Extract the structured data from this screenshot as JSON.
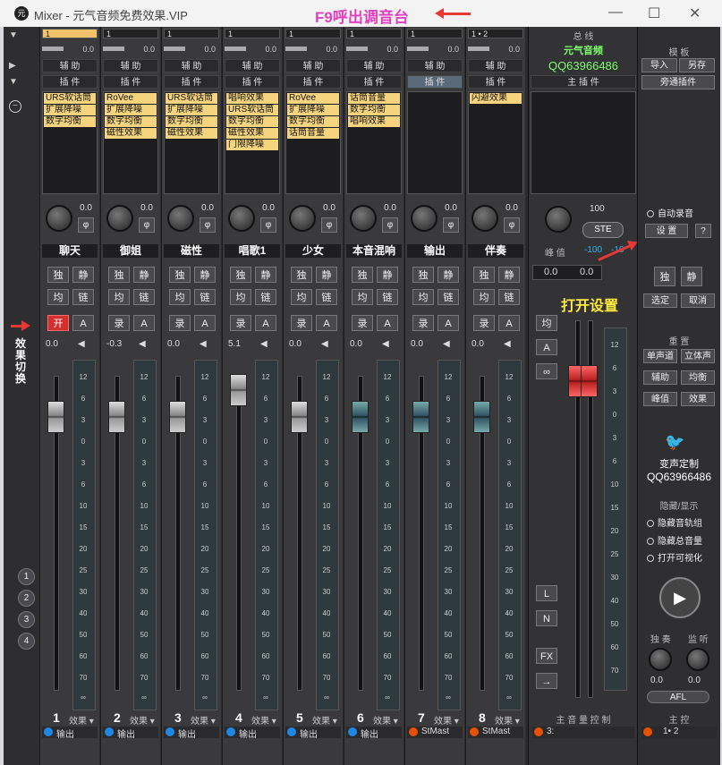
{
  "window": {
    "title": "Mixer - 元气音频免费效果.VIP",
    "annotation": "F9呼出调音台",
    "logo": "元"
  },
  "left": {
    "effect_switch_label": "效果切换",
    "nums": [
      "1",
      "2",
      "3",
      "4"
    ]
  },
  "channels": [
    {
      "select": "1",
      "meter": "0.0",
      "header1": "辅 助",
      "header2": "插 件",
      "plugins": [
        "URS软话筒",
        "扩展降噪",
        "数字均衡"
      ],
      "pan": "0.0",
      "name": "聊天",
      "rec": "开",
      "vol": "0.0",
      "num": "1",
      "fx": "效果",
      "out": "输出",
      "out_color": "blue"
    },
    {
      "select": "1",
      "meter": "0.0",
      "header1": "辅 助",
      "header2": "插 件",
      "plugins": [
        "RoVee",
        "扩展降噪",
        "数字均衡",
        "磁性效果"
      ],
      "pan": "0.0",
      "name": "御姐",
      "rec": "录",
      "vol": "-0.3",
      "num": "2",
      "fx": "效果",
      "out": "输出",
      "out_color": "blue"
    },
    {
      "select": "1",
      "meter": "0.0",
      "header1": "辅 助",
      "header2": "插 件",
      "plugins": [
        "URS软话筒",
        "扩展降噪",
        "数字均衡",
        "磁性效果"
      ],
      "pan": "0.0",
      "name": "磁性",
      "rec": "录",
      "vol": "0.0",
      "num": "3",
      "fx": "效果",
      "out": "输出",
      "out_color": "blue"
    },
    {
      "select": "1",
      "meter": "0.0",
      "header1": "辅 助",
      "header2": "插 件",
      "plugins": [
        "唱响效果",
        "URS软话筒",
        "数字均衡",
        "磁性效果",
        "门限降噪"
      ],
      "pan": "0.0",
      "name": "唱歌1",
      "rec": "录",
      "vol": "5.1",
      "num": "4",
      "fx": "效果",
      "out": "输出",
      "out_color": "blue"
    },
    {
      "select": "1",
      "meter": "0.0",
      "header1": "辅 助",
      "header2": "插 件",
      "plugins": [
        "RoVee",
        "扩展降噪",
        "数字均衡",
        "话筒音量"
      ],
      "pan": "0.0",
      "name": "少女",
      "rec": "录",
      "vol": "0.0",
      "num": "5",
      "fx": "效果",
      "out": "输出",
      "out_color": "blue"
    },
    {
      "select": "1",
      "meter": "0.0",
      "header1": "辅 助",
      "header2": "插 件",
      "plugins": [
        "话筒音量",
        "数字均衡",
        "唱响效果"
      ],
      "pan": "0.0",
      "name": "本音混响",
      "rec": "录",
      "vol": "0.0",
      "num": "6",
      "fx": "效果",
      "out": "输出",
      "out_color": "blue"
    },
    {
      "select": "1",
      "meter": "0.0",
      "header1": "辅 助",
      "header2": "插 件",
      "plugins": [],
      "pan": "0.0",
      "name": "输出",
      "rec": "录",
      "vol": "0.0",
      "num": "7",
      "fx": "效果",
      "out": "StMast",
      "out_color": "orange"
    },
    {
      "select": "1 • 2",
      "meter": "0.0",
      "header1": "辅 助",
      "header2": "插 件",
      "plugins": [
        "闪避效果"
      ],
      "pan": "0.0",
      "name": "伴奏",
      "rec": "录",
      "vol": "0.0",
      "num": "8",
      "fx": "效果",
      "out": "StMast",
      "out_color": "orange"
    }
  ],
  "button_labels": {
    "solo": "独",
    "mute": "静",
    "eq": "均",
    "link": "链",
    "auto": "A"
  },
  "scale_ticks": [
    "12",
    "6",
    "3",
    "0",
    "3",
    "6",
    "10",
    "15",
    "20",
    "25",
    "30",
    "40",
    "50",
    "60",
    "70"
  ],
  "master": {
    "bus_label": "总 线",
    "brand": "元气音频",
    "qq": "QQ63966486",
    "plugins_label": "主 插 件",
    "pan_value": "100",
    "ste": "STE",
    "peak_label": "峰 值",
    "peak_l": "-100",
    "peak_r": "-10",
    "db_l": "0.0",
    "db_r": "0.0",
    "annotation": "打开设置",
    "eq": "均",
    "auto": "A",
    "link": "∞",
    "L": "L",
    "N": "N",
    "FX": "FX",
    "control_label": "主 音 量 控 制",
    "out": "3:"
  },
  "right": {
    "template": "模 板",
    "import": "导入",
    "save_as": "另存",
    "bypass": "旁通插件",
    "auto_rec": "自动录音",
    "settings": "设 置",
    "help": "?",
    "solo": "独",
    "mute": "静",
    "select": "选定",
    "cancel": "取消",
    "reset": "重 置",
    "mono": "单声道",
    "stereo": "立体声",
    "aux": "辅助",
    "eq": "均衡",
    "peak": "峰值",
    "effect": "效果",
    "custom": "变声定制",
    "qq": "QQ63966486",
    "hide_show": "隐藏/显示",
    "hide_tracks": "隐藏音轨组",
    "hide_master": "隐藏总音量",
    "open_vis": "打开可视化",
    "solo_play": "独 奏",
    "monitor": "监 听",
    "v1": "0.0",
    "v2": "0.0",
    "afl": "AFL",
    "master_label": "主 控",
    "out": "1• 2"
  },
  "colors": {
    "plugin_bg": "#f6d47e",
    "rec_red": "#d32f2f",
    "master_red": "#e53935",
    "accent_green": "#7cfc6a"
  }
}
